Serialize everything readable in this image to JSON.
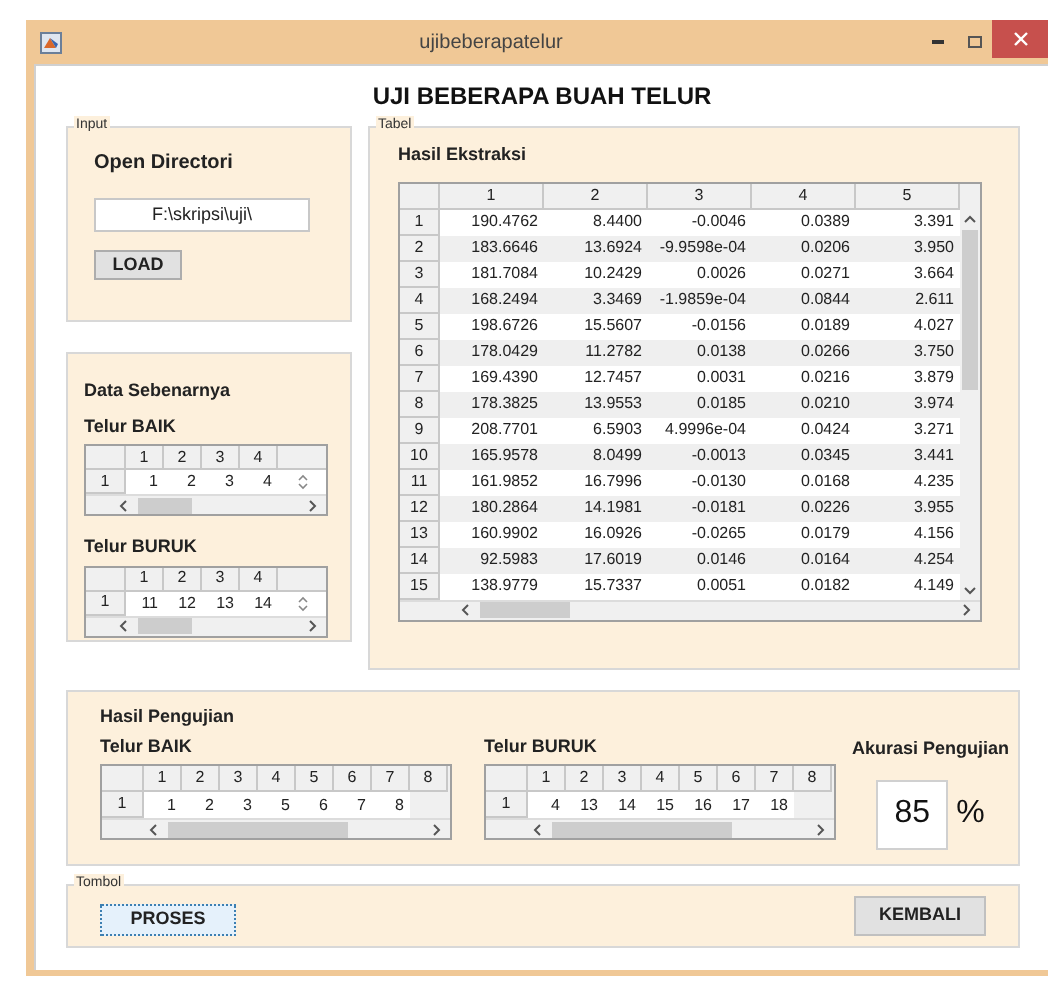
{
  "window": {
    "title": "ujibeberapatelur"
  },
  "heading": "UJI BEBERAPA BUAH TELUR",
  "input_panel": {
    "legend": "Input",
    "label": "Open Directori",
    "path_field": {
      "value": "F:\\skripsi\\uji\\"
    },
    "button": "LOAD"
  },
  "data_panel": {
    "title": "Data Sebenarnya",
    "tables": [
      {
        "label": "Telur BAIK",
        "columns": [
          "1",
          "2",
          "3",
          "4"
        ],
        "rows": [
          {
            "header": "1",
            "cells": [
              "1",
              "2",
              "3",
              "4"
            ]
          }
        ]
      },
      {
        "label": "Telur BURUK",
        "columns": [
          "1",
          "2",
          "3",
          "4"
        ],
        "rows": [
          {
            "header": "1",
            "cells": [
              "11",
              "12",
              "13",
              "14"
            ]
          }
        ]
      }
    ]
  },
  "table_panel": {
    "legend": "Tabel",
    "title": "Hasil Ekstraksi",
    "table": {
      "columns": [
        "1",
        "2",
        "3",
        "4",
        "5"
      ],
      "rows": [
        {
          "header": "1",
          "cells": [
            "190.4762",
            "8.4400",
            "-0.0046",
            "0.0389",
            "3.391"
          ]
        },
        {
          "header": "2",
          "cells": [
            "183.6646",
            "13.6924",
            "-9.9598e-04",
            "0.0206",
            "3.950"
          ]
        },
        {
          "header": "3",
          "cells": [
            "181.7084",
            "10.2429",
            "0.0026",
            "0.0271",
            "3.664"
          ]
        },
        {
          "header": "4",
          "cells": [
            "168.2494",
            "3.3469",
            "-1.9859e-04",
            "0.0844",
            "2.611"
          ]
        },
        {
          "header": "5",
          "cells": [
            "198.6726",
            "15.5607",
            "-0.0156",
            "0.0189",
            "4.027"
          ]
        },
        {
          "header": "6",
          "cells": [
            "178.0429",
            "11.2782",
            "0.0138",
            "0.0266",
            "3.750"
          ]
        },
        {
          "header": "7",
          "cells": [
            "169.4390",
            "12.7457",
            "0.0031",
            "0.0216",
            "3.879"
          ]
        },
        {
          "header": "8",
          "cells": [
            "178.3825",
            "13.9553",
            "0.0185",
            "0.0210",
            "3.974"
          ]
        },
        {
          "header": "9",
          "cells": [
            "208.7701",
            "6.5903",
            "4.9996e-04",
            "0.0424",
            "3.271"
          ]
        },
        {
          "header": "10",
          "cells": [
            "165.9578",
            "8.0499",
            "-0.0013",
            "0.0345",
            "3.441"
          ]
        },
        {
          "header": "11",
          "cells": [
            "161.9852",
            "16.7996",
            "-0.0130",
            "0.0168",
            "4.235"
          ]
        },
        {
          "header": "12",
          "cells": [
            "180.2864",
            "14.1981",
            "-0.0181",
            "0.0226",
            "3.955"
          ]
        },
        {
          "header": "13",
          "cells": [
            "160.9902",
            "16.0926",
            "-0.0265",
            "0.0179",
            "4.156"
          ]
        },
        {
          "header": "14",
          "cells": [
            "92.5983",
            "17.6019",
            "0.0146",
            "0.0164",
            "4.254"
          ]
        },
        {
          "header": "15",
          "cells": [
            "138.9779",
            "15.7337",
            "0.0051",
            "0.0182",
            "4.149"
          ]
        }
      ]
    }
  },
  "result_panel": {
    "title": "Hasil Pengujian",
    "tables": [
      {
        "label": "Telur BAIK",
        "columns": [
          "1",
          "2",
          "3",
          "4",
          "5",
          "6",
          "7",
          "8"
        ],
        "rows": [
          {
            "header": "1",
            "cells": [
              "1",
              "2",
              "3",
              "5",
              "6",
              "7",
              "8"
            ]
          }
        ]
      },
      {
        "label": "Telur BURUK",
        "columns": [
          "1",
          "2",
          "3",
          "4",
          "5",
          "6",
          "7",
          "8"
        ],
        "rows": [
          {
            "header": "1",
            "cells": [
              "4",
              "13",
              "14",
              "15",
              "16",
              "17",
              "18"
            ]
          }
        ]
      }
    ],
    "accuracy": {
      "label": "Akurasi Pengujian",
      "value": "85",
      "unit": "%"
    }
  },
  "buttons_panel": {
    "legend": "Tombol",
    "buttons": [
      {
        "label": "PROSES",
        "focused": true
      },
      {
        "label": "KEMBALI",
        "focused": false
      }
    ]
  }
}
